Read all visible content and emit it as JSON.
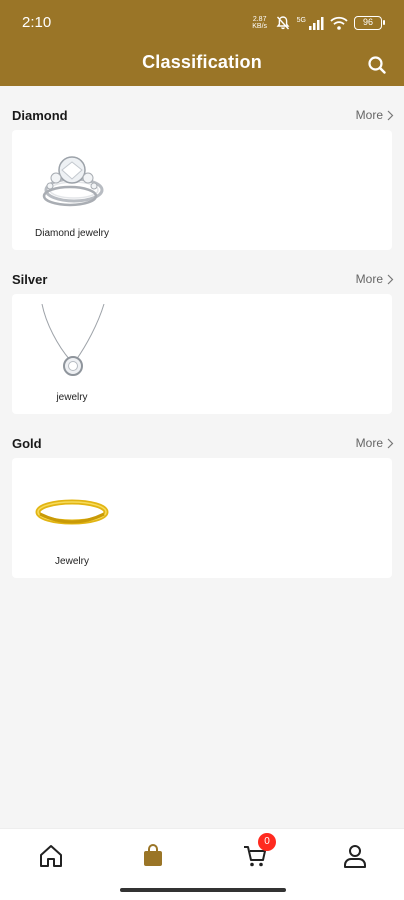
{
  "status_bar": {
    "time": "2:10",
    "net_speed_value": "2.87",
    "net_speed_unit": "KB/s",
    "network": "5G",
    "battery": "96"
  },
  "header": {
    "title": "Classification",
    "search_icon": "search-icon",
    "background_color": "#9a7527"
  },
  "sections": [
    {
      "title": "Diamond",
      "more": "More",
      "items": [
        {
          "label": "Diamond jewelry",
          "icon": "diamond-ring-image"
        }
      ]
    },
    {
      "title": "Silver",
      "more": "More",
      "items": [
        {
          "label": "jewelry",
          "icon": "silver-necklace-image"
        }
      ]
    },
    {
      "title": "Gold",
      "more": "More",
      "items": [
        {
          "label": "Jewelry",
          "icon": "gold-bracelet-image"
        }
      ]
    }
  ],
  "bottom_nav": {
    "items": [
      {
        "name": "home",
        "icon": "home-icon"
      },
      {
        "name": "category",
        "icon": "bag-icon",
        "active": true
      },
      {
        "name": "cart",
        "icon": "cart-icon",
        "badge": "0"
      },
      {
        "name": "profile",
        "icon": "user-icon"
      }
    ],
    "active_color": "#9a7527",
    "badge_color": "#ff2a1f"
  }
}
